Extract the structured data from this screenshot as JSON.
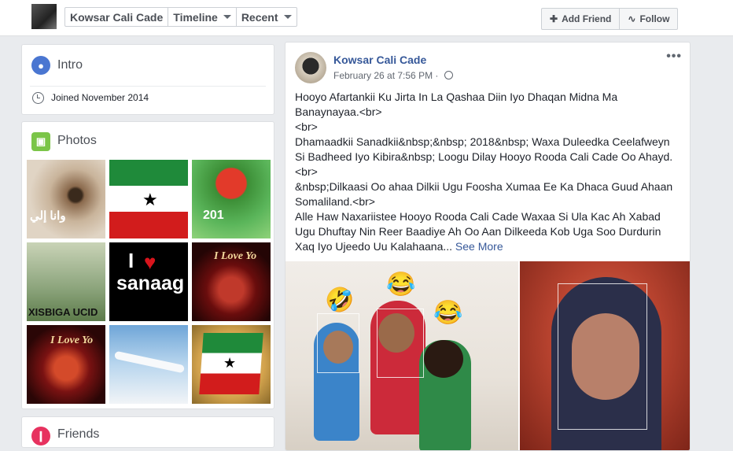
{
  "header": {
    "profile_name": "Kowsar Cali Cade",
    "nav_timeline": "Timeline",
    "nav_recent": "Recent",
    "add_friend": "Add Friend",
    "follow": "Follow"
  },
  "intro": {
    "title": "Intro",
    "joined": "Joined November 2014"
  },
  "photos": {
    "title": "Photos",
    "items": [
      {
        "name": "eye-photo",
        "caption": "وانا إلي"
      },
      {
        "name": "flag-photo",
        "caption": ""
      },
      {
        "name": "rose-2017-photo",
        "caption": "201"
      },
      {
        "name": "xisbiga-photo",
        "caption": "XISBIGA UCID"
      },
      {
        "name": "i-love-sanaag-photo",
        "caption": "sanaag",
        "caption2": "I"
      },
      {
        "name": "i-love-you-heart-photo",
        "caption": "I Love Yo"
      },
      {
        "name": "i-love-you-heart2-photo",
        "caption": "I Love Yo"
      },
      {
        "name": "airplane-photo",
        "caption": ""
      },
      {
        "name": "somaliland-flag-photo",
        "caption": ""
      }
    ]
  },
  "friends": {
    "title": "Friends"
  },
  "post": {
    "author": "Kowsar Cali Cade",
    "date": "February 26 at 7:56 PM",
    "lines": [
      "Hooyo Afartankii Ku Jirta In La Qashaa Diin Iyo Dhaqan Midna Ma",
      "Banaynayaa.<br>",
      "<br>",
      "Dhamaadkii Sanadkii&nbsp;&nbsp; 2018&nbsp; Waxa Duleedka Ceelafweyn",
      "Si Badheed Iyo Kibira&nbsp; Loogu Dilay Hooyo Rooda Cali Cade Oo Ahayd.",
      "<br>",
      "&nbsp;Dilkaasi Oo ahaa Dilkii Ugu Foosha Xumaa Ee Ka Dhaca Guud Ahaan",
      "Somaliland.<br>",
      "Alle Haw Naxariistee Hooyo Rooda Cali Cade Waxaa Si Ula Kac Ah Xabad",
      "Ugu Dhuftay Nin Reer Baadiye Ah Oo Aan Dilkeeda Kob Uga Soo Durdurin"
    ],
    "last_line": "Xaq Iyo Ujeedo Uu Kalahaana...",
    "see_more": "See More",
    "emojis": [
      "🤣",
      "😂",
      "😂"
    ]
  }
}
